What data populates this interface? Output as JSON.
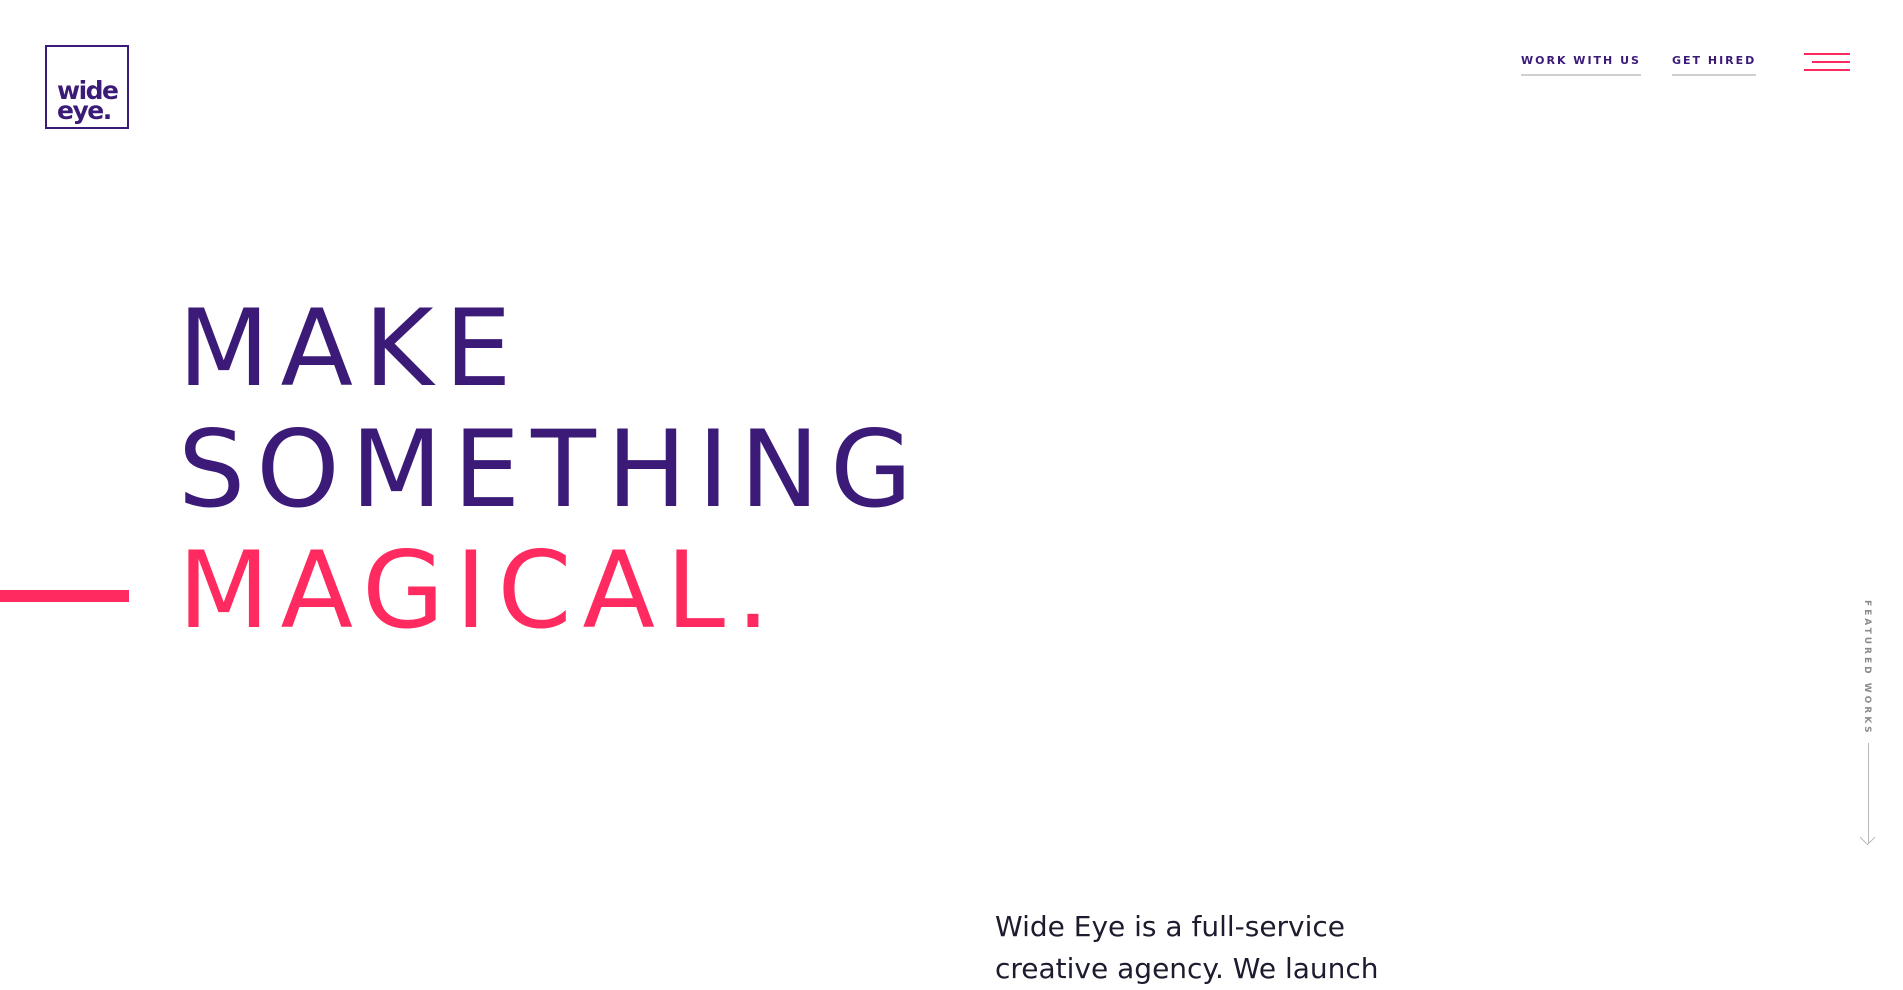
{
  "logo": {
    "line1": "wide",
    "line2": "eye."
  },
  "nav": {
    "work_with_us": "WORK WITH US",
    "get_hired": "GET HIRED"
  },
  "hero": {
    "line1": "MAKE",
    "line2": "SOMETHING",
    "line3": "MAGICAL."
  },
  "sidebar": {
    "featured_works": "FEATURED WORKS"
  },
  "intro": {
    "text": "Wide Eye is a full-service creative agency. We launch"
  },
  "colors": {
    "brand_purple": "#3b1a78",
    "accent_pink": "#ff2a5f"
  },
  "icons": {
    "menu": "hamburger-menu-icon",
    "arrow": "arrow-down-icon"
  }
}
